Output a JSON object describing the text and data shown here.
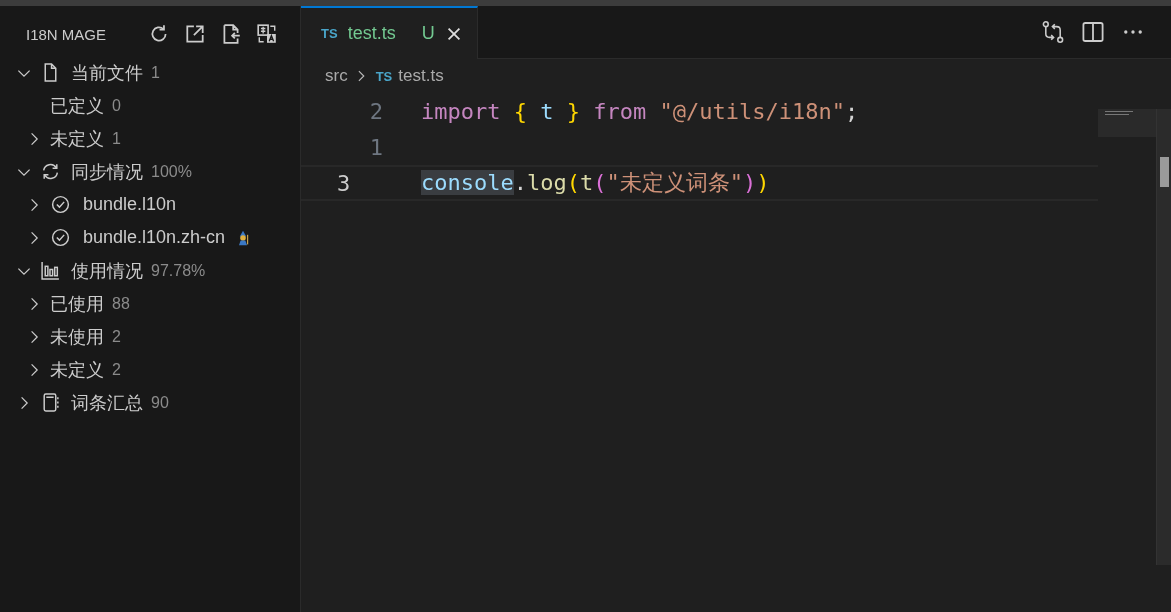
{
  "sidebar": {
    "title": "I18N MAGE",
    "tree": [
      {
        "kind": "file",
        "label": "当前文件",
        "count": "1",
        "expanded": true,
        "children": [
          {
            "kind": "leaf",
            "label": "已定义",
            "count": "0"
          },
          {
            "kind": "entry",
            "label": "未定义",
            "count": "1",
            "expanded": false
          }
        ]
      },
      {
        "kind": "sync",
        "label": "同步情况",
        "count": "100%",
        "expanded": true,
        "children": [
          {
            "kind": "bundle",
            "label": "bundle.l10n",
            "expanded": false,
            "badge": false
          },
          {
            "kind": "bundle",
            "label": "bundle.l10n.zh-cn",
            "expanded": false,
            "badge": true
          }
        ]
      },
      {
        "kind": "usage",
        "label": "使用情况",
        "count": "97.78%",
        "expanded": true,
        "children": [
          {
            "kind": "entry",
            "label": "已使用",
            "count": "88",
            "expanded": false
          },
          {
            "kind": "entry",
            "label": "未使用",
            "count": "2",
            "expanded": false
          },
          {
            "kind": "entry",
            "label": "未定义",
            "count": "2",
            "expanded": false
          }
        ]
      },
      {
        "kind": "entries",
        "label": "词条汇总",
        "count": "90",
        "expanded": false
      }
    ]
  },
  "tabs": [
    {
      "badge": "TS",
      "label": "test.ts",
      "status": "U",
      "selected": true
    }
  ],
  "breadcrumb": {
    "folder": "src",
    "file_badge": "TS",
    "file": "test.ts"
  },
  "lines": [
    {
      "number": "2",
      "current": false,
      "tokens": [
        {
          "kind": "keyword",
          "text": "import "
        },
        {
          "kind": "brace",
          "text": "{ "
        },
        {
          "kind": "var",
          "text": "t "
        },
        {
          "kind": "brace",
          "text": "} "
        },
        {
          "kind": "keyword",
          "text": "from "
        },
        {
          "kind": "string",
          "text": "\"@/utils/i18n\""
        },
        {
          "kind": "plain",
          "text": ";"
        }
      ]
    },
    {
      "number": "1",
      "current": false
    },
    {
      "number": "3",
      "current": true,
      "tokens": [
        {
          "kind": "var",
          "text": "console",
          "highlighted": true
        },
        {
          "kind": "plain",
          "text": "."
        },
        {
          "kind": "func",
          "text": "log"
        },
        {
          "kind": "brace",
          "text": "("
        },
        {
          "kind": "func",
          "text": "t"
        },
        {
          "kind": "paren2",
          "text": "("
        },
        {
          "kind": "string",
          "text": "\"未定义词条\""
        },
        {
          "kind": "paren2",
          "text": ")"
        },
        {
          "kind": "brace",
          "text": ")"
        }
      ]
    }
  ]
}
